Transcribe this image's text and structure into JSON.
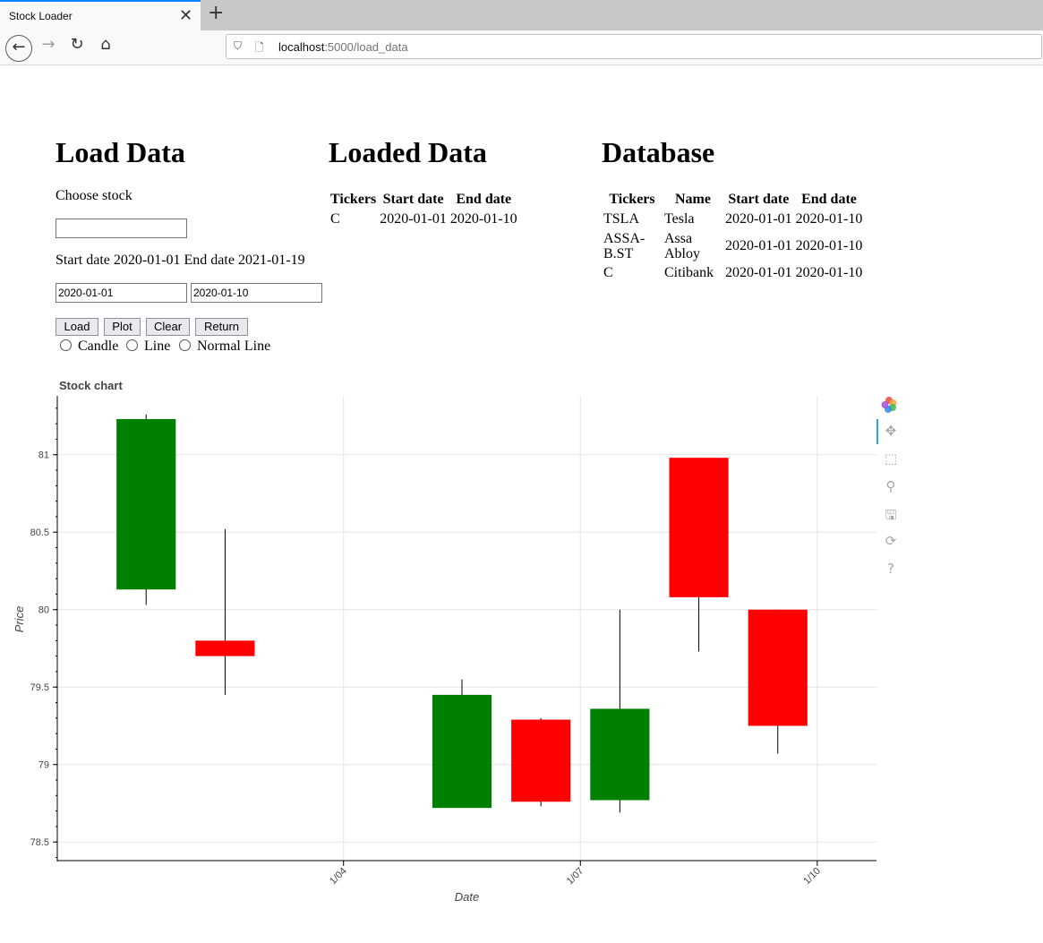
{
  "browser": {
    "tab_title": "Stock Loader",
    "tab_close": "✕",
    "new_tab": "+",
    "url_host": "localhost",
    "url_rest": ":5000/load_data"
  },
  "load_data": {
    "heading": "Load Data",
    "choose_label": "Choose stock",
    "stock_value": "",
    "dates_label": "Start date 2020-01-01 End date 2021-01-19",
    "start_value": "2020-01-01",
    "end_value": "2020-01-10",
    "buttons": [
      "Load",
      "Plot",
      "Clear",
      "Return"
    ],
    "radios": [
      "Candle",
      "Line",
      "Normal Line"
    ]
  },
  "loaded_data": {
    "heading": "Loaded Data",
    "columns": [
      "Tickers",
      "Start date",
      "End date"
    ],
    "rows": [
      [
        "C",
        "2020-01-01",
        "2020-01-10"
      ]
    ]
  },
  "database": {
    "heading": "Database",
    "columns": [
      "Tickers",
      "Name",
      "Start date",
      "End date"
    ],
    "rows": [
      [
        "TSLA",
        "Tesla",
        "2020-01-01",
        "2020-01-10"
      ],
      [
        "ASSA-B.ST",
        "Assa Abloy",
        "2020-01-01",
        "2020-01-10"
      ],
      [
        "C",
        "Citibank",
        "2020-01-01",
        "2020-01-10"
      ]
    ]
  },
  "chart_data": {
    "type": "candlestick",
    "title": "Stock chart",
    "xlabel": "Date",
    "ylabel": "Price",
    "ylim": [
      78.38,
      81.38
    ],
    "xlim": [
      "2019-12-31T09:00",
      "2020-01-10T18:00"
    ],
    "x_ticks": [
      {
        "date": "2020-01-04",
        "label": "1/04"
      },
      {
        "date": "2020-01-07",
        "label": "1/07"
      },
      {
        "date": "2020-01-10",
        "label": "1/10"
      }
    ],
    "y_ticks": [
      78.5,
      79,
      79.5,
      80,
      80.5,
      81
    ],
    "grid": true,
    "up_color": "#008000",
    "down_color": "#ff0000",
    "candles": [
      {
        "date": "2020-01-01",
        "open": 80.13,
        "close": 81.23,
        "high": 81.26,
        "low": 80.03
      },
      {
        "date": "2020-01-02",
        "open": 79.8,
        "close": 79.7,
        "high": 80.52,
        "low": 79.45
      },
      {
        "date": "2020-01-05",
        "open": 78.72,
        "close": 79.45,
        "high": 79.55,
        "low": 78.72
      },
      {
        "date": "2020-01-06",
        "open": 79.29,
        "close": 78.76,
        "high": 79.3,
        "low": 78.73
      },
      {
        "date": "2020-01-07",
        "open": 78.77,
        "close": 79.36,
        "high": 80.0,
        "low": 78.69
      },
      {
        "date": "2020-01-08",
        "open": 80.98,
        "close": 80.08,
        "high": 80.98,
        "low": 79.73
      },
      {
        "date": "2020-01-09",
        "open": 80.0,
        "close": 79.25,
        "high": 80.0,
        "low": 79.07
      }
    ]
  }
}
